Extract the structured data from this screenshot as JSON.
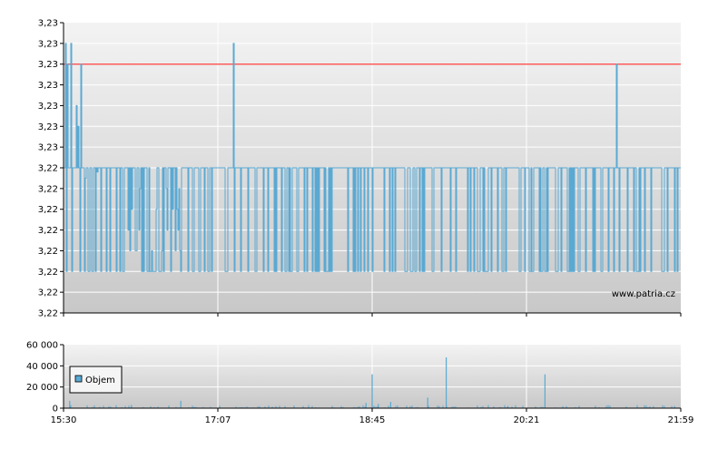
{
  "chart_data": [
    {
      "type": "line",
      "name": "price",
      "y_tick_labels": [
        "3,23",
        "3,23",
        "3,23",
        "3,23",
        "3,23",
        "3,23",
        "3,23",
        "3,22",
        "3,22",
        "3,22",
        "3,22",
        "3,22",
        "3,22",
        "3,22",
        "3,22"
      ],
      "x_tick_labels": [
        "15:30",
        "17:07",
        "18:45",
        "20:21",
        "21:59"
      ],
      "reference_line": {
        "level_index": 12
      },
      "series": [
        {
          "color": "#5aa9d3",
          "points": [
            [
              0,
              7
            ],
            [
              0.3,
              13
            ],
            [
              0.6,
              12
            ],
            [
              0.9,
              7
            ],
            [
              1.2,
              13
            ],
            [
              1.6,
              7
            ],
            [
              2,
              10
            ],
            [
              2.4,
              9
            ],
            [
              2.8,
              12
            ],
            [
              3.1,
              7
            ],
            [
              3.5,
              6.5
            ],
            [
              4,
              7
            ],
            [
              4.5,
              2
            ],
            [
              5,
              7
            ],
            [
              5.5,
              6.8
            ],
            [
              6,
              7
            ],
            [
              7,
              7
            ],
            [
              8,
              7
            ],
            [
              8.5,
              2
            ],
            [
              9,
              7
            ],
            [
              10,
              7
            ],
            [
              11,
              7
            ],
            [
              12,
              7
            ],
            [
              13,
              7
            ],
            [
              14,
              7
            ],
            [
              15,
              7
            ],
            [
              16,
              7
            ],
            [
              17,
              7
            ],
            [
              18,
              7
            ],
            [
              19,
              7
            ],
            [
              20,
              7
            ],
            [
              21,
              7
            ],
            [
              22,
              7
            ],
            [
              23,
              7
            ],
            [
              24,
              7
            ],
            [
              25,
              7
            ],
            [
              26,
              7
            ],
            [
              27,
              7
            ],
            [
              27.5,
              13
            ],
            [
              28,
              7
            ],
            [
              29,
              7
            ],
            [
              30,
              7
            ],
            [
              31,
              7
            ],
            [
              32,
              7
            ],
            [
              33,
              7
            ],
            [
              34,
              7
            ],
            [
              35,
              7
            ],
            [
              36,
              7
            ],
            [
              37,
              7
            ],
            [
              38,
              7
            ],
            [
              39,
              7
            ],
            [
              40,
              7
            ],
            [
              41,
              7
            ],
            [
              42,
              7
            ],
            [
              43,
              7
            ],
            [
              44,
              7
            ],
            [
              45,
              7
            ],
            [
              46,
              7
            ],
            [
              47,
              7
            ],
            [
              48,
              7
            ],
            [
              49,
              7
            ],
            [
              50,
              7
            ],
            [
              51,
              7
            ],
            [
              52,
              7
            ],
            [
              53,
              7
            ],
            [
              54,
              7
            ],
            [
              55,
              7
            ],
            [
              56,
              7
            ],
            [
              57,
              7
            ],
            [
              58,
              7
            ],
            [
              59,
              7
            ],
            [
              60,
              7
            ],
            [
              61,
              7
            ],
            [
              62,
              7
            ],
            [
              63,
              7
            ],
            [
              64,
              7
            ],
            [
              65,
              7
            ],
            [
              66,
              7
            ],
            [
              67,
              7
            ],
            [
              68,
              7
            ],
            [
              69,
              7
            ],
            [
              70,
              7
            ],
            [
              71,
              7
            ],
            [
              72,
              7
            ],
            [
              73,
              7
            ],
            [
              74,
              7
            ],
            [
              75,
              7
            ],
            [
              76,
              7
            ],
            [
              77,
              7
            ],
            [
              78,
              7
            ],
            [
              79,
              7
            ],
            [
              80,
              7
            ],
            [
              81,
              7
            ],
            [
              82,
              7
            ],
            [
              83,
              7
            ],
            [
              84,
              7
            ],
            [
              85,
              7
            ],
            [
              86,
              7
            ],
            [
              87,
              7
            ],
            [
              88,
              7
            ],
            [
              89,
              7
            ],
            [
              89.5,
              12
            ],
            [
              90,
              7
            ],
            [
              91,
              7
            ],
            [
              92,
              7
            ],
            [
              93,
              7
            ],
            [
              94,
              7
            ],
            [
              95,
              7
            ],
            [
              96,
              7
            ],
            [
              97,
              7
            ],
            [
              98,
              7
            ],
            [
              99,
              7
            ],
            [
              100,
              7
            ]
          ]
        }
      ],
      "watermark": "www.patria.cz"
    },
    {
      "type": "bar",
      "name": "volume",
      "y_tick_labels": [
        "60 000",
        "40 000",
        "20 000",
        "0"
      ],
      "ylim": [
        0,
        60000
      ],
      "legend": {
        "label": "Objem",
        "position": "top-left"
      },
      "color": "#5aa9d3",
      "spikes": [
        [
          1,
          7000
        ],
        [
          11,
          3000
        ],
        [
          19,
          7000
        ],
        [
          49,
          5000
        ],
        [
          50,
          32000
        ],
        [
          51,
          4000
        ],
        [
          53,
          6000
        ],
        [
          59,
          10000
        ],
        [
          62,
          48000
        ],
        [
          72,
          2000
        ],
        [
          78,
          32000
        ],
        [
          99,
          2000
        ]
      ]
    }
  ]
}
